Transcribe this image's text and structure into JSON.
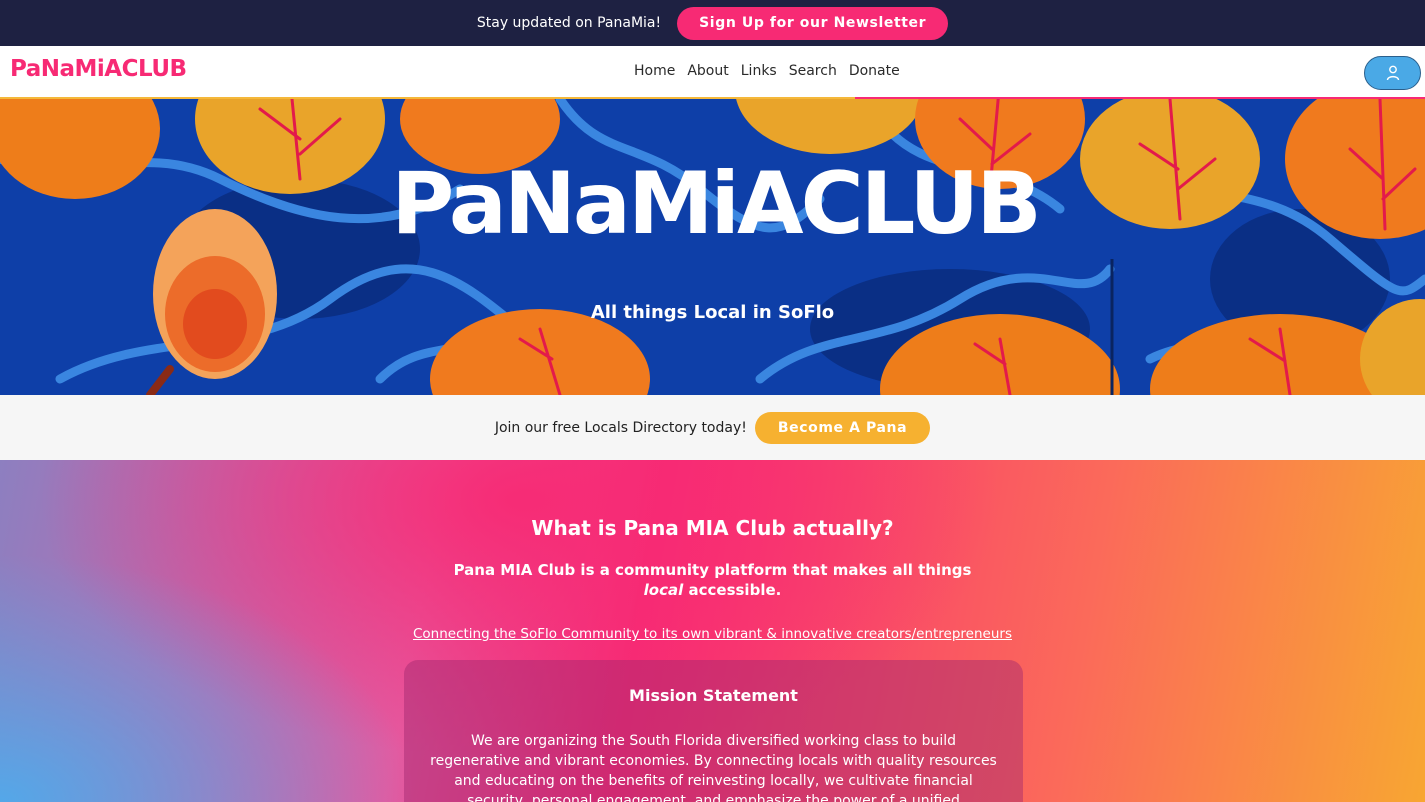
{
  "topbar": {
    "text": "Stay updated on PanaMia!",
    "newsletter_button": "Sign Up for our Newsletter"
  },
  "nav": {
    "logo_text": "PaNaMiACLUB",
    "links": [
      "Home",
      "About",
      "Links",
      "Search",
      "Donate"
    ],
    "profile_icon": "user-icon"
  },
  "hero": {
    "logo_text": "PaNaMiACLUB",
    "tagline": "All things Local in SoFlo"
  },
  "join": {
    "text": "Join our free Locals Directory today!",
    "button": "Become A Pana"
  },
  "about": {
    "title": "What is Pana MIA Club actually?",
    "desc_before": "Pana MIA Club is a community platform that makes all things",
    "desc_emphasis": "local",
    "desc_after": "accessible.",
    "link": "Connecting the SoFlo Community to its own vibrant & innovative creators/entrepreneurs",
    "mission_title": "Mission Statement",
    "mission_body": "We are organizing the South Florida diversified working class to build regenerative and vibrant economies. By connecting locals with quality resources and educating on the benefits of reinvesting locally, we cultivate financial security, personal engagement, and emphasize the power of a unified community."
  },
  "colors": {
    "topbar_bg": "#1e2142",
    "brand_pink": "#f72a74",
    "brand_yellow": "#f6b130",
    "profile_blue": "#4aa9e6",
    "hero_blue": "#0d3ca3"
  }
}
